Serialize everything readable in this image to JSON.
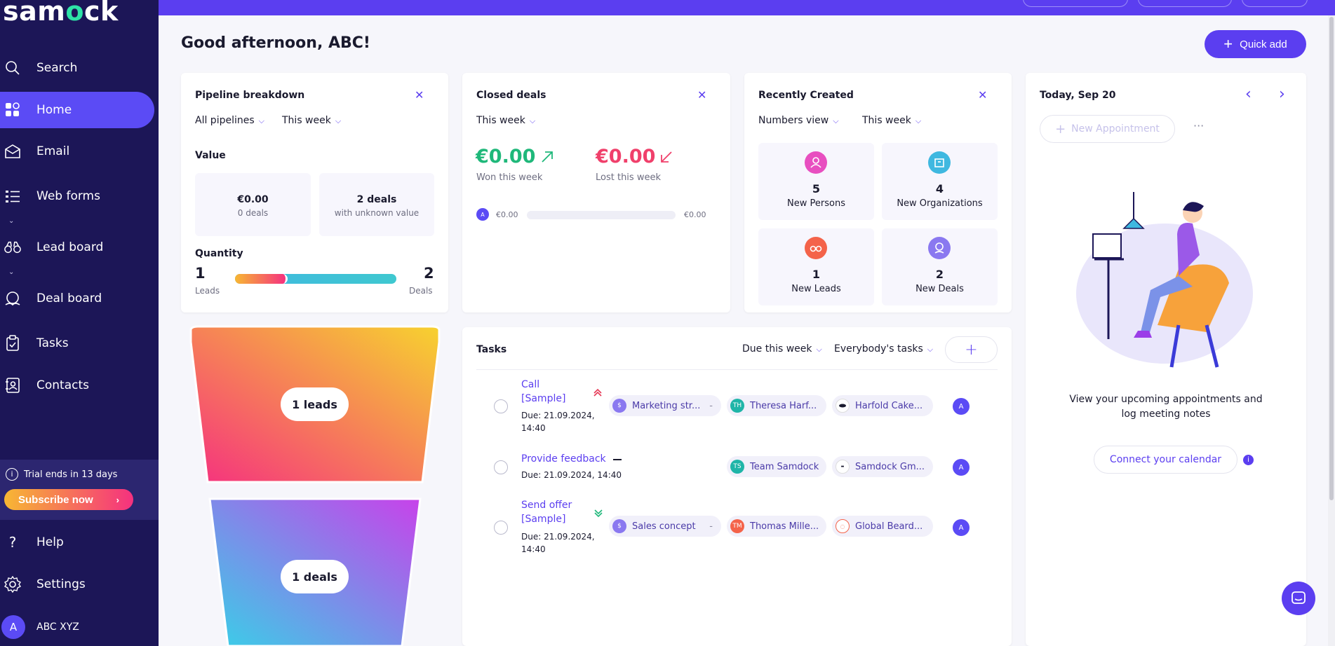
{
  "app": {
    "logo_text": "samdock",
    "logo_pre": "sam",
    "logo_o": "o",
    "logo_post": "ck"
  },
  "sidebar": {
    "items": [
      {
        "label": "Search",
        "icon": "search-icon"
      },
      {
        "label": "Home",
        "icon": "home-grid-icon",
        "active": true
      },
      {
        "label": "Email",
        "icon": "email-icon"
      },
      {
        "label": "Web forms",
        "icon": "web-forms-icon"
      },
      {
        "label": "Lead board",
        "icon": "binoculars-icon"
      },
      {
        "label": "Deal board",
        "icon": "deal-icon"
      },
      {
        "label": "Tasks",
        "icon": "clipboard-icon"
      },
      {
        "label": "Contacts",
        "icon": "contacts-icon"
      }
    ],
    "trial_text": "Trial ends in 13 days",
    "subscribe_label": "Subscribe now",
    "help_label": "Help",
    "settings_label": "Settings",
    "user_initial": "A",
    "user_name": "ABC XYZ"
  },
  "header": {
    "greeting": "Good afternoon, ABC!",
    "quick_add": "Quick add"
  },
  "pipeline": {
    "title": "Pipeline breakdown",
    "filter_pipeline": "All pipelines",
    "filter_period": "This week",
    "value_label": "Value",
    "value_amount": "€0.00",
    "value_deals": "0 deals",
    "unknown_count": "2 deals",
    "unknown_label": "with unknown value",
    "quantity_label": "Quantity",
    "leads_count": "1",
    "leads_label": "Leads",
    "deals_count": "2",
    "deals_label": "Deals",
    "funnel_leads": "1 leads",
    "funnel_deals": "1 deals"
  },
  "closed": {
    "title": "Closed deals",
    "period": "This week",
    "won_amount": "€0.00",
    "won_label": "Won this week",
    "lost_amount": "€0.00",
    "lost_label": "Lost this week",
    "avatar_initial": "A",
    "bar_left": "€0.00",
    "bar_right": "€0.00"
  },
  "recent": {
    "title": "Recently Created",
    "view": "Numbers view",
    "period": "This week",
    "tiles": [
      {
        "count": "5",
        "label": "New Persons",
        "color": "#e84fc0"
      },
      {
        "count": "4",
        "label": "New Organizations",
        "color": "#3fb8e0"
      },
      {
        "count": "1",
        "label": "New Leads",
        "color": "#f4634a"
      },
      {
        "count": "2",
        "label": "New Deals",
        "color": "#8a78f0"
      }
    ]
  },
  "calendar": {
    "date": "Today, Sep 20",
    "new_appointment": "New Appointment",
    "more": "···",
    "empty_text_1": "View your upcoming appointments and",
    "empty_text_2": "log meeting notes",
    "connect": "Connect your calendar"
  },
  "tasks": {
    "title": "Tasks",
    "filter_due": "Due this week",
    "filter_who": "Everybody's tasks",
    "rows": [
      {
        "title_1": "Call",
        "title_2": "[Sample]",
        "priority": "high",
        "due_1": "Due: 21.09.2024,",
        "due_2": "14:40",
        "deal": "Marketing str...",
        "person": "Theresa Harf...",
        "person_initials": "TH",
        "person_color": "#1fb5a8",
        "org": "Harfold Cake...",
        "assignee": "A"
      },
      {
        "title_1": "Provide feedback",
        "title_2": "",
        "priority": "medium",
        "due_1": "Due: 21.09.2024, 14:40",
        "due_2": "",
        "deal": "",
        "person": "Team Samdock",
        "person_initials": "TS",
        "person_color": "#1fb5a8",
        "org": "Samdock Gm...",
        "assignee": "A"
      },
      {
        "title_1": "Send offer",
        "title_2": "[Sample]",
        "priority": "low",
        "due_1": "Due: 21.09.2024,",
        "due_2": "14:40",
        "deal": "Sales concept",
        "person": "Thomas Mille...",
        "person_initials": "TM",
        "person_color": "#f4634a",
        "org": "Global Beard...",
        "assignee": "A"
      }
    ]
  },
  "chat": {
    "icon": "chat-icon"
  }
}
